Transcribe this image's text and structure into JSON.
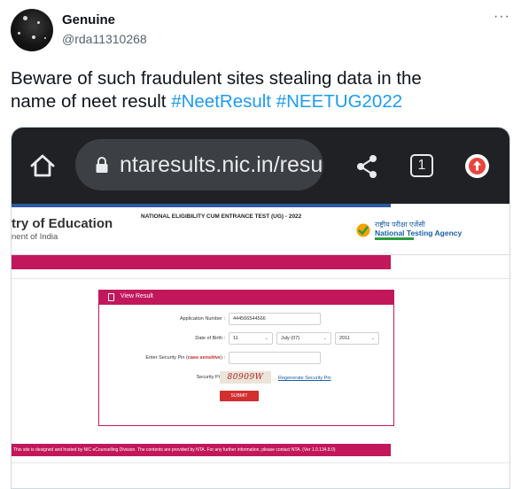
{
  "tweet": {
    "author_name": "Genuine",
    "author_handle": "@rda11310268",
    "more_label": "···",
    "text_line1": "Beware of such fraudulent sites stealing data in the",
    "text_line2_prefix": "name of neet result ",
    "hashtags": [
      "#NeetResult",
      "#NEETUG2022"
    ]
  },
  "browser": {
    "url": "ntaresults.nic.in/resu",
    "tab_count": "1"
  },
  "site": {
    "ministry_title": "try of Education",
    "govt_line": "nent of India",
    "exam_title": "NATIONAL ELIGIBILITY CUM ENTRANCE TEST (UG) - 2022",
    "nta_hindi": "राष्ट्रीय परीक्षा एजेंसी",
    "nta_english": "National Testing Agency",
    "panel_title": "View Result",
    "form": {
      "application_label": "Application Number :",
      "application_value": "444566544566",
      "dob_label": "Date of Birth :",
      "dob_day": "11",
      "dob_month": "July (07)",
      "dob_year": "2011",
      "security_pin_label_prefix": "Enter Security Pin (",
      "security_pin_label_emph": "case sensitive",
      "security_pin_label_suffix": ") :",
      "security_pin_value": "",
      "captcha_label": "Security Pin :",
      "captcha_text": "80909W",
      "regenerate_label": "Regenerate Security Pin",
      "submit_label": "SUBMIT"
    },
    "footer_text": "This site is designed and hosted by NIC eCounselling Division. The contents are provided by NTA. For any further information, please contact NTA. (Ver 1.0.134.8.0)"
  },
  "colors": {
    "hashtag": "#1d9bf0",
    "site_accent": "#c2185b",
    "chrome_bar": "#202124"
  }
}
